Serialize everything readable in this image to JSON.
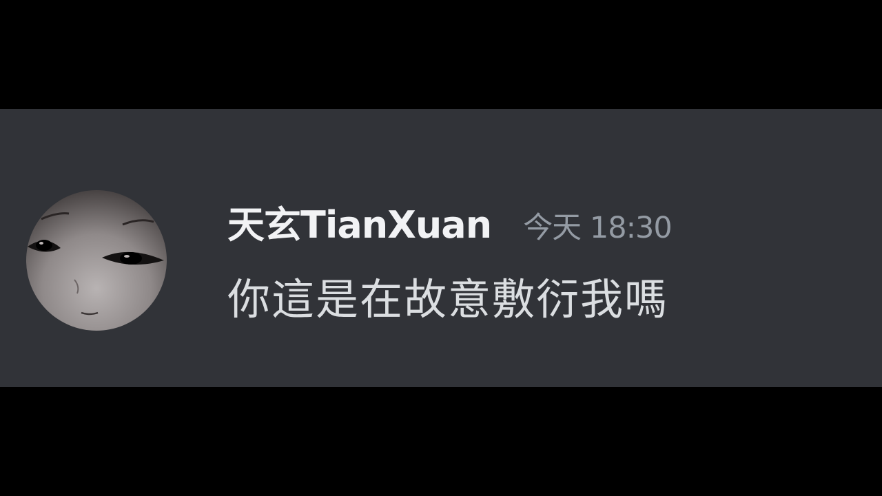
{
  "message": {
    "author": {
      "username": "天玄TianXuan",
      "avatar_icon": "user-avatar"
    },
    "timestamp": "今天 18:30",
    "content": "你這是在故意敷衍我嗎"
  },
  "colors": {
    "panel_background": "#313338",
    "username": "#f2f3f5",
    "timestamp": "#949ba4",
    "content": "#dbdee1"
  }
}
